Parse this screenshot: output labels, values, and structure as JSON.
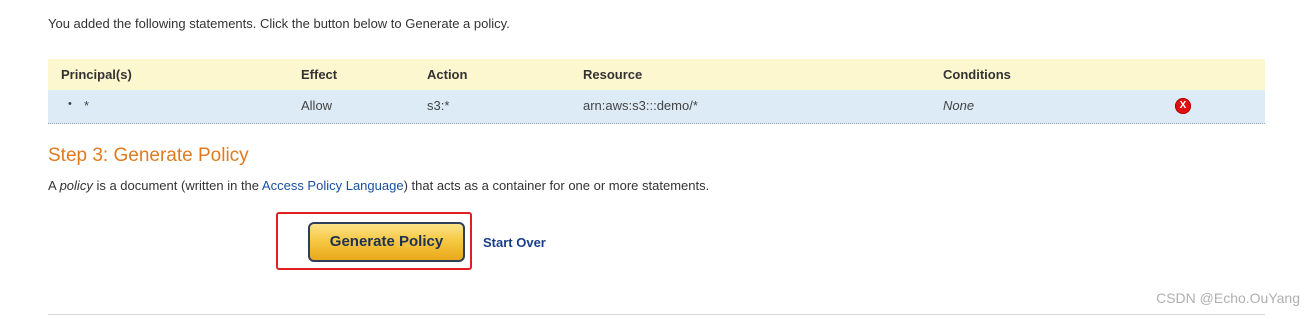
{
  "intro_text": "You added the following statements. Click the button below to Generate a policy.",
  "statements_table": {
    "columns": [
      "Principal(s)",
      "Effect",
      "Action",
      "Resource",
      "Conditions"
    ],
    "rows": [
      {
        "principal": "*",
        "effect": "Allow",
        "action": "s3:*",
        "resource": "arn:aws:s3:::demo/*",
        "conditions": "None",
        "delete_label": "X"
      }
    ]
  },
  "step3": {
    "title": "Step 3: Generate Policy",
    "desc_prefix": "A ",
    "desc_policy_word": "policy",
    "desc_middle": " is a document (written in the ",
    "desc_link": "Access Policy Language",
    "desc_suffix": ") that acts as a container for one or more statements."
  },
  "actions": {
    "generate_label": "Generate Policy",
    "start_over_label": "Start Over"
  },
  "watermark": "CSDN @Echo.OuYang",
  "colors": {
    "header_bg": "#fdf7d0",
    "row_bg": "#ddebf6",
    "step_title": "#e07b1f",
    "link": "#1a4fa0",
    "highlight": "#e02020",
    "delete": "#e01010"
  }
}
